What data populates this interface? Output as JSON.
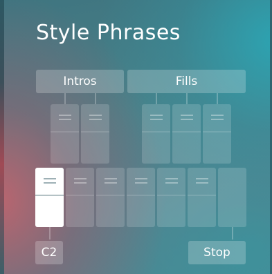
{
  "panel": {
    "title": "Style Phrases"
  },
  "groups": {
    "intros_label": "Intros",
    "fills_label": "Fills"
  },
  "keys": {
    "start_label": "C2",
    "stop_label": "Stop"
  },
  "colors": {
    "active_phrase": "#ffffff",
    "label_text": "#ffffff"
  },
  "icons": {
    "phrase_grip": "drag-handle-icon"
  }
}
